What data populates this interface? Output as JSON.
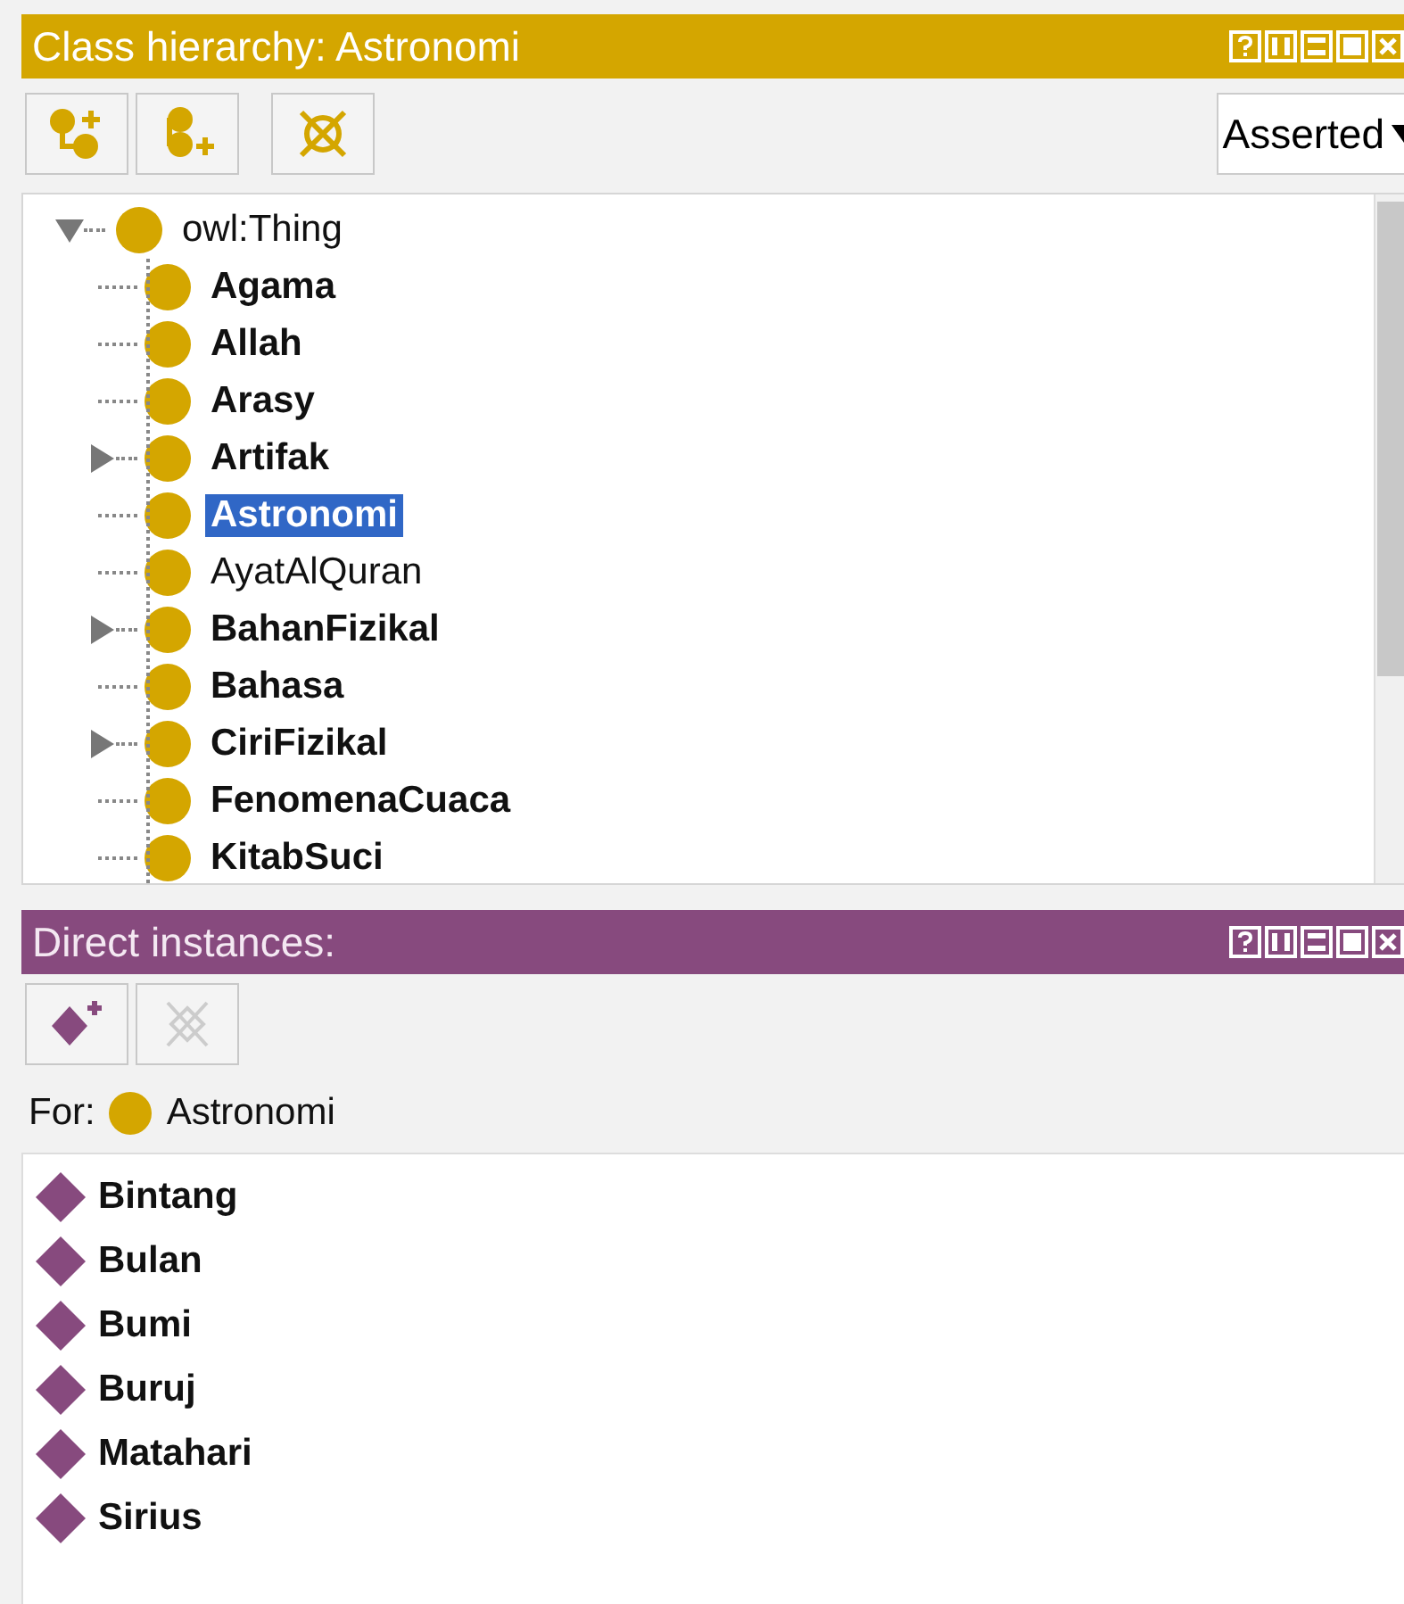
{
  "class_panel": {
    "title": "Class hierarchy: Astronomi",
    "view_selector": {
      "value": "Asserted"
    },
    "tree": {
      "label": "owl:Thing",
      "expanded": true,
      "children": [
        {
          "label": "Agama",
          "bold": true,
          "kind": "leaf",
          "selected": false
        },
        {
          "label": "Allah",
          "bold": true,
          "kind": "leaf",
          "selected": false
        },
        {
          "label": "Arasy",
          "bold": true,
          "kind": "leaf",
          "selected": false
        },
        {
          "label": "Artifak",
          "bold": true,
          "kind": "collapsed",
          "selected": false
        },
        {
          "label": "Astronomi",
          "bold": true,
          "kind": "leaf",
          "selected": true
        },
        {
          "label": "AyatAlQuran",
          "bold": false,
          "kind": "leaf",
          "selected": false
        },
        {
          "label": "BahanFizikal",
          "bold": true,
          "kind": "collapsed",
          "selected": false
        },
        {
          "label": "Bahasa",
          "bold": true,
          "kind": "leaf",
          "selected": false
        },
        {
          "label": "CiriFizikal",
          "bold": true,
          "kind": "collapsed",
          "selected": false
        },
        {
          "label": "FenomenaCuaca",
          "bold": true,
          "kind": "leaf",
          "selected": false
        },
        {
          "label": "KitabSuci",
          "bold": true,
          "kind": "leaf",
          "selected": false
        }
      ]
    }
  },
  "instances_panel": {
    "title": "Direct instances:",
    "for_label": "For:",
    "for_class": "Astronomi",
    "delete_disabled": true,
    "instances": [
      {
        "label": "Bintang"
      },
      {
        "label": "Bulan"
      },
      {
        "label": "Bumi"
      },
      {
        "label": "Buruj"
      },
      {
        "label": "Matahari"
      },
      {
        "label": "Sirius"
      }
    ]
  }
}
